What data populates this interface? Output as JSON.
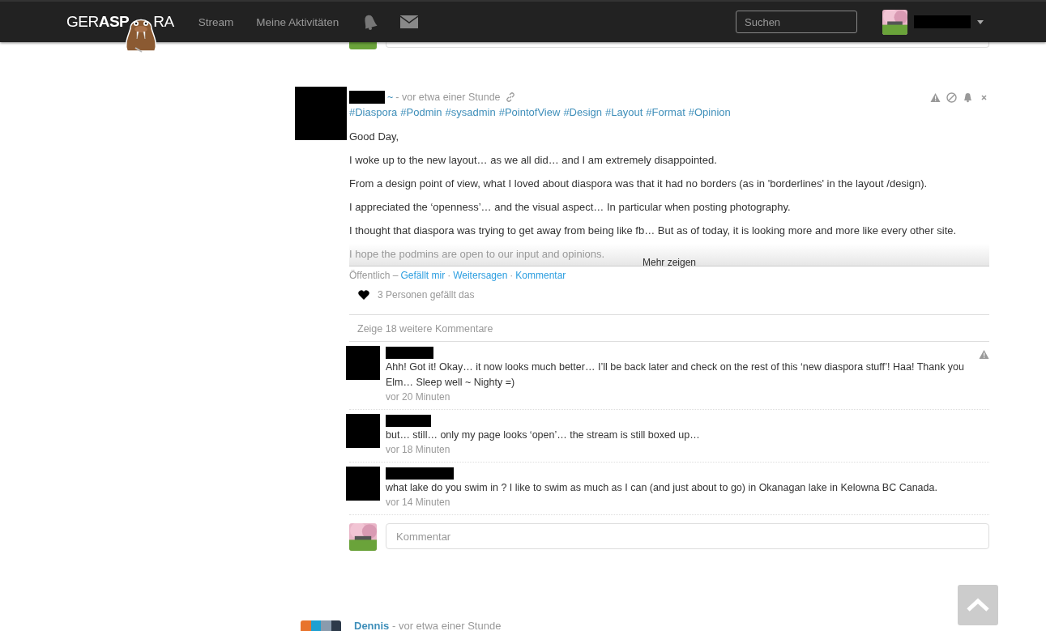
{
  "header": {
    "logo": {
      "prefix": "GER",
      "middle": "ASP",
      "suffix": "RA"
    },
    "nav": [
      {
        "label": "Stream"
      },
      {
        "label": "Meine Aktivitäten"
      }
    ],
    "search": {
      "placeholder": "Suchen"
    }
  },
  "post": {
    "author_suffix": "~",
    "time": "- vor etwa einer Stunde",
    "tags": [
      "#Diaspora",
      "#Podmin",
      "#sysadmin",
      "#PointofView",
      "#Design",
      "#Layout",
      "#Format",
      "#Opinion"
    ],
    "paragraphs": [
      "Good Day,",
      "I woke up to the new layout… as we all did… and I am extremely disappointed.",
      "From a design point of view, what I loved about diaspora was that it had no borders (as in 'borderlines' in the layout /design).",
      "I appreciated the ‘openness’… and the visual aspect… In particular when posting photography.",
      "I thought that diaspora was trying to get away from being like fb… But as of today, it is looking more and more like every other site."
    ],
    "faded_paragraph": "I hope the podmins are open to our input and opinions.",
    "more": "Mehr zeigen",
    "visibility": "Öffentlich –",
    "actions": [
      "Gefällt mir",
      "Weitersagen",
      "Kommentar"
    ],
    "separator": "·",
    "likes": "3 Personen gefällt das",
    "show_more_comments": "Zeige 18 weitere Kommentare",
    "comments": [
      {
        "text": "Ahh! Got it! Okay… it now looks much better… I’ll be back later and check on the rest of this ‘new diaspora stuff’! Haa! Thank you Elm… Sleep well ~ Nighty =)",
        "time": "vor 20 Minuten",
        "report_shown": true
      },
      {
        "text": "but… still… only my page looks ‘open’… the stream is still boxed up…",
        "time": "vor 18 Minuten",
        "report_shown": false
      },
      {
        "text": "what lake do you swim in ? I like to swim as much as I can (and just about to go) in Okanagan lake in Kelowna BC Canada.",
        "time": "vor 14 Minuten",
        "report_shown": false
      }
    ],
    "comment_placeholder": "Kommentar"
  },
  "next_post": {
    "author": "Dennis",
    "time": "- vor etwa einer Stunde"
  }
}
